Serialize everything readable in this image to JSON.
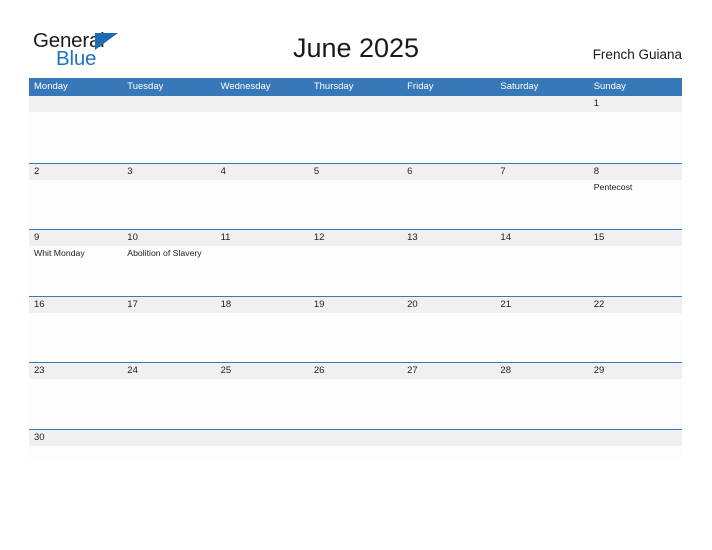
{
  "brand": {
    "word_one": "General",
    "word_two": "Blue",
    "triangle_icon": "triangle-icon",
    "accent_color": "#1e6cb0"
  },
  "header": {
    "title": "June 2025",
    "region": "French Guiana"
  },
  "theme": {
    "header_blue": "#3778b8",
    "row_rule_blue": "#3778b8",
    "day_band_gray": "#f0f0f0",
    "page_background": "#ffffff",
    "text_color": "#1d1d1d"
  },
  "calendar": {
    "weekdays": [
      "Monday",
      "Tuesday",
      "Wednesday",
      "Thursday",
      "Friday",
      "Saturday",
      "Sunday"
    ],
    "weeks": [
      {
        "days": [
          {
            "date": "",
            "event": ""
          },
          {
            "date": "",
            "event": ""
          },
          {
            "date": "",
            "event": ""
          },
          {
            "date": "",
            "event": ""
          },
          {
            "date": "",
            "event": ""
          },
          {
            "date": "",
            "event": ""
          },
          {
            "date": "1",
            "event": ""
          }
        ]
      },
      {
        "days": [
          {
            "date": "2",
            "event": ""
          },
          {
            "date": "3",
            "event": ""
          },
          {
            "date": "4",
            "event": ""
          },
          {
            "date": "5",
            "event": ""
          },
          {
            "date": "6",
            "event": ""
          },
          {
            "date": "7",
            "event": ""
          },
          {
            "date": "8",
            "event": "Pentecost"
          }
        ]
      },
      {
        "days": [
          {
            "date": "9",
            "event": "Whit Monday"
          },
          {
            "date": "10",
            "event": "Abolition of Slavery"
          },
          {
            "date": "11",
            "event": ""
          },
          {
            "date": "12",
            "event": ""
          },
          {
            "date": "13",
            "event": ""
          },
          {
            "date": "14",
            "event": ""
          },
          {
            "date": "15",
            "event": ""
          }
        ]
      },
      {
        "days": [
          {
            "date": "16",
            "event": ""
          },
          {
            "date": "17",
            "event": ""
          },
          {
            "date": "18",
            "event": ""
          },
          {
            "date": "19",
            "event": ""
          },
          {
            "date": "20",
            "event": ""
          },
          {
            "date": "21",
            "event": ""
          },
          {
            "date": "22",
            "event": ""
          }
        ]
      },
      {
        "days": [
          {
            "date": "23",
            "event": ""
          },
          {
            "date": "24",
            "event": ""
          },
          {
            "date": "25",
            "event": ""
          },
          {
            "date": "26",
            "event": ""
          },
          {
            "date": "27",
            "event": ""
          },
          {
            "date": "28",
            "event": ""
          },
          {
            "date": "29",
            "event": ""
          }
        ]
      },
      {
        "days": [
          {
            "date": "30",
            "event": ""
          },
          {
            "date": "",
            "event": ""
          },
          {
            "date": "",
            "event": ""
          },
          {
            "date": "",
            "event": ""
          },
          {
            "date": "",
            "event": ""
          },
          {
            "date": "",
            "event": ""
          },
          {
            "date": "",
            "event": ""
          }
        ]
      }
    ]
  }
}
